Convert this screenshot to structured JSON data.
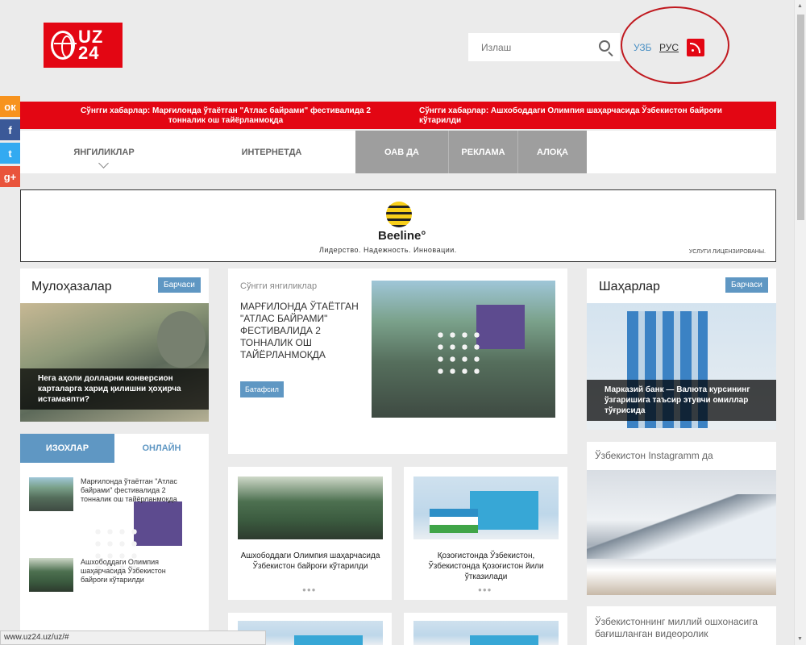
{
  "header": {
    "logo_text": "UZ 24",
    "search_placeholder": "Излаш",
    "lang_uz": "УЗБ",
    "lang_ru": "РУС"
  },
  "social": {
    "ok": "ок",
    "fb": "f",
    "tw": "t",
    "gp": "g+"
  },
  "ticker": {
    "items": [
      "Сўнгги хабарлар: Марғилонда ўтаётган \"Атлас байрами\" фестивалида 2 тонналик ош тайёрланмоқда",
      "Сўнгги хабарлар: Ашхободдаги Олимпия шаҳарчасида Ўзбекистон байроғи кўтарилди"
    ]
  },
  "nav": {
    "items": [
      "ЯНГИЛИКЛАР",
      "ИНТЕРНЕТДА",
      "ОАВ ДА",
      "РЕКЛАМА",
      "АЛОҚА"
    ]
  },
  "banner": {
    "brand": "Beeline°",
    "tagline": "Лидерство. Надежность. Инновации.",
    "license": "УСЛУГИ ЛИЦЕНЗИРОВАНЫ."
  },
  "opinions": {
    "title": "Мулоҳазалар",
    "all_label": "Барчаси",
    "caption": "Нега аҳоли долларни конверсион карталарга харид қилишни ҳоҳирча истамаяпти?"
  },
  "latest": {
    "label": "Сўнгги янгиликлар",
    "headline": "МАРҒИЛОНДА ЎТАЁТГАН \"АТЛАС БАЙРАМИ\" ФЕСТИВАЛИДА 2 ТОННАЛИК ОШ ТАЙЁРЛАНМОҚДА",
    "more_label": "Батафсил"
  },
  "regions": {
    "title": "Шаҳарлар",
    "all_label": "Барчаси",
    "caption": "Марказий банк — Валюта курсининг ўзгаришига таъсир этувчи омиллар тўғрисида"
  },
  "tabs": {
    "active": "ИЗОХЛАР",
    "inactive": "ОНЛАЙН"
  },
  "side_news": [
    "Марғилонда ўтаётган \"Атлас байрами\" фестивалида 2 тонналик ош тайёрланмоқда",
    "Ашхободдаги Олимпия шаҳарчасида Ўзбекистон байроғи кўтарилди"
  ],
  "news_cards": [
    {
      "title": "Ашхободдаги Олимпия шаҳарчасида Ўзбекистон байроғи кўтарилди",
      "dots": "●●●"
    },
    {
      "title": "Қозоғистонда Ўзбекистон, Ўзбекистонда Қозоғистон йили ўтказилади",
      "dots": "●●●"
    }
  ],
  "instagram": {
    "title": "Ўзбекистон Instagramm да"
  },
  "video": {
    "title": "Ўзбекистоннинг миллий ошхонасига бағишланган видеоролик"
  },
  "status_bar": {
    "url": "www.uz24.uz/uz/#"
  },
  "colors": {
    "brand_red": "#e30613",
    "accent_blue": "#5f97c3",
    "nav_grey": "#9e9e9e"
  }
}
